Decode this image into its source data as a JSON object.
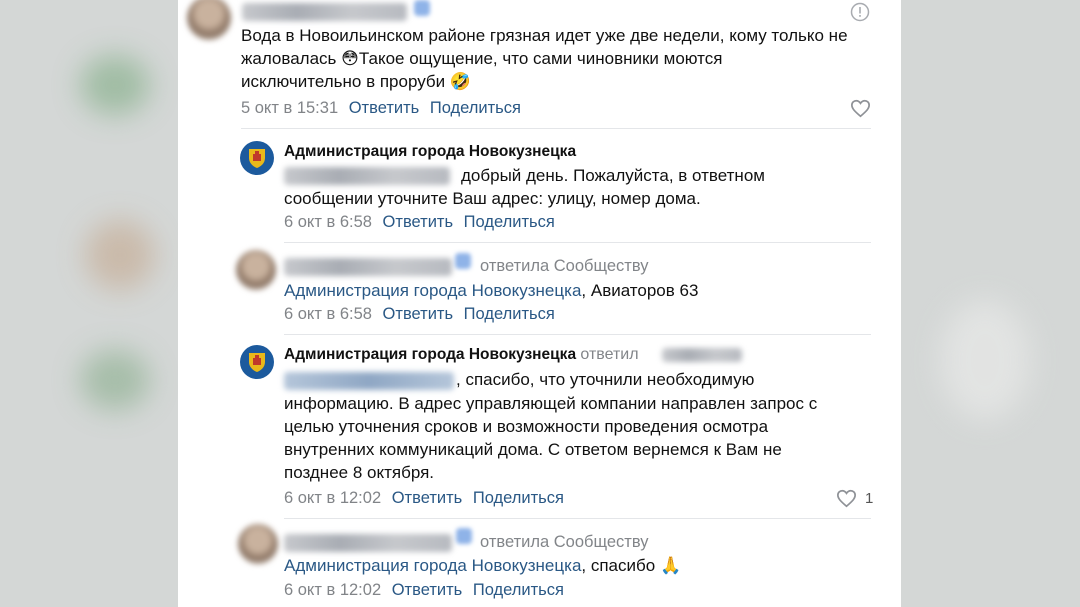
{
  "comments": [
    {
      "text_lines": [
        "Вода в Новоильинском районе грязная идет уже две недели, кому только не",
        "жаловалась ",
        "Такое ощущение, что сами чиновники моются",
        "исключительно в проруби "
      ],
      "emoji_1": "😳",
      "emoji_2": "🤣",
      "time": "5 окт в 15:31",
      "reply_label": "Ответить",
      "share_label": "Поделиться"
    },
    {
      "author": "Администрация города Новокузнецка",
      "text_lines": [
        "добрый день. Пожалуйста, в ответном",
        "сообщении уточните Ваш адрес: улицу, номер дома."
      ],
      "time": "6 окт в 6:58",
      "reply_label": "Ответить",
      "share_label": "Поделиться"
    },
    {
      "reply_to": "ответила Сообществу",
      "mention": "Администрация города Новокузнецка",
      "text": ", Авиаторов 63",
      "time": "6 окт в 6:58",
      "reply_label": "Ответить",
      "share_label": "Поделиться"
    },
    {
      "author": "Администрация города Новокузнецка",
      "reply_to": "ответил",
      "text_lines": [
        ", спасибо, что уточнили необходимую",
        "информацию. В адрес управляющей компании направлен запрос с",
        "целью уточнения сроков и возможности проведения осмотра",
        "внутренних коммуникаций дома. С ответом вернемся к Вам не",
        "позднее 8 октября."
      ],
      "time": "6 окт в 12:02",
      "reply_label": "Ответить",
      "share_label": "Поделиться",
      "likes": "1"
    },
    {
      "reply_to": "ответила Сообществу",
      "mention": "Администрация города Новокузнецка",
      "text": ", спасибо ",
      "emoji": "🙏",
      "time": "6 окт в 12:02",
      "reply_label": "Ответить",
      "share_label": "Поделиться"
    }
  ],
  "icons": {
    "report": "exclamation-circle-icon",
    "like": "heart-icon",
    "admin_avatar": "city-coat-of-arms-icon"
  },
  "colors": {
    "link": "#2a5885",
    "muted": "#818488",
    "admin_avatar_bg": "#1c5a9d"
  }
}
